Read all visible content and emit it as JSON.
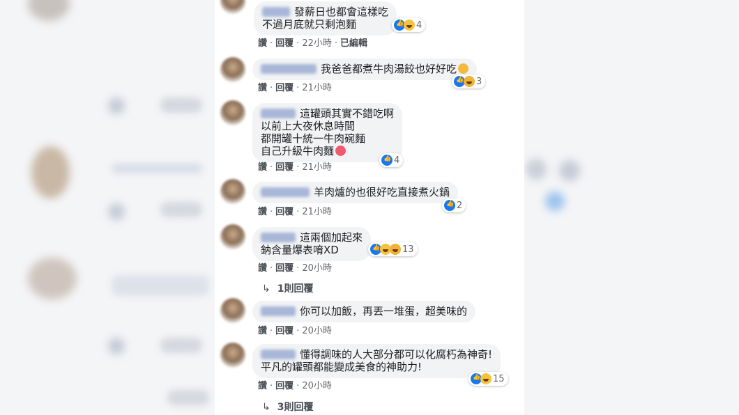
{
  "comments": [
    {
      "lines": [
        "發薪日也都會這樣吃",
        "不過月底就只剩泡麵"
      ],
      "reactions": "4",
      "like": "讚",
      "reply": "回覆",
      "time": "22小時",
      "edited": "已編輯"
    },
    {
      "lines": [
        "我爸爸都煮牛肉湯餃也好好吃"
      ],
      "reactions": "3",
      "like": "讚",
      "reply": "回覆",
      "time": "21小時"
    },
    {
      "lines": [
        "這罐頭其實不錯吃啊",
        "以前上大夜休息時間",
        "都開罐十統一牛肉碗麵",
        "自己升級牛肉麵"
      ],
      "reactions": "4",
      "like": "讚",
      "reply": "回覆",
      "time": "21小時"
    },
    {
      "lines": [
        "羊肉爐的也很好吃直接煮火鍋"
      ],
      "reactions": "2",
      "like": "讚",
      "reply": "回覆",
      "time": "21小時"
    },
    {
      "lines": [
        "這兩個加起來",
        "鈉含量爆表唷XD"
      ],
      "reactions": "13",
      "like": "讚",
      "reply": "回覆",
      "time": "20小時",
      "replies": "1則回覆"
    },
    {
      "lines": [
        "你可以加飯，再丟一堆蛋，超美味的"
      ],
      "like": "讚",
      "reply": "回覆",
      "time": "20小時"
    },
    {
      "lines": [
        "懂得調味的人大部分都可以化腐朽為神奇!",
        "平凡的罐頭都能變成美食的神助力!"
      ],
      "reactions": "15",
      "like": "讚",
      "reply": "回覆",
      "time": "20小時",
      "replies": "3則回覆"
    }
  ],
  "colors": {
    "like_blue": "#1877f2",
    "bubble_bg": "#f2f3f5",
    "meta_gray": "#65676b"
  },
  "icons": [
    "like-icon",
    "haha-icon",
    "wow-icon",
    "reply-arrow-icon"
  ]
}
